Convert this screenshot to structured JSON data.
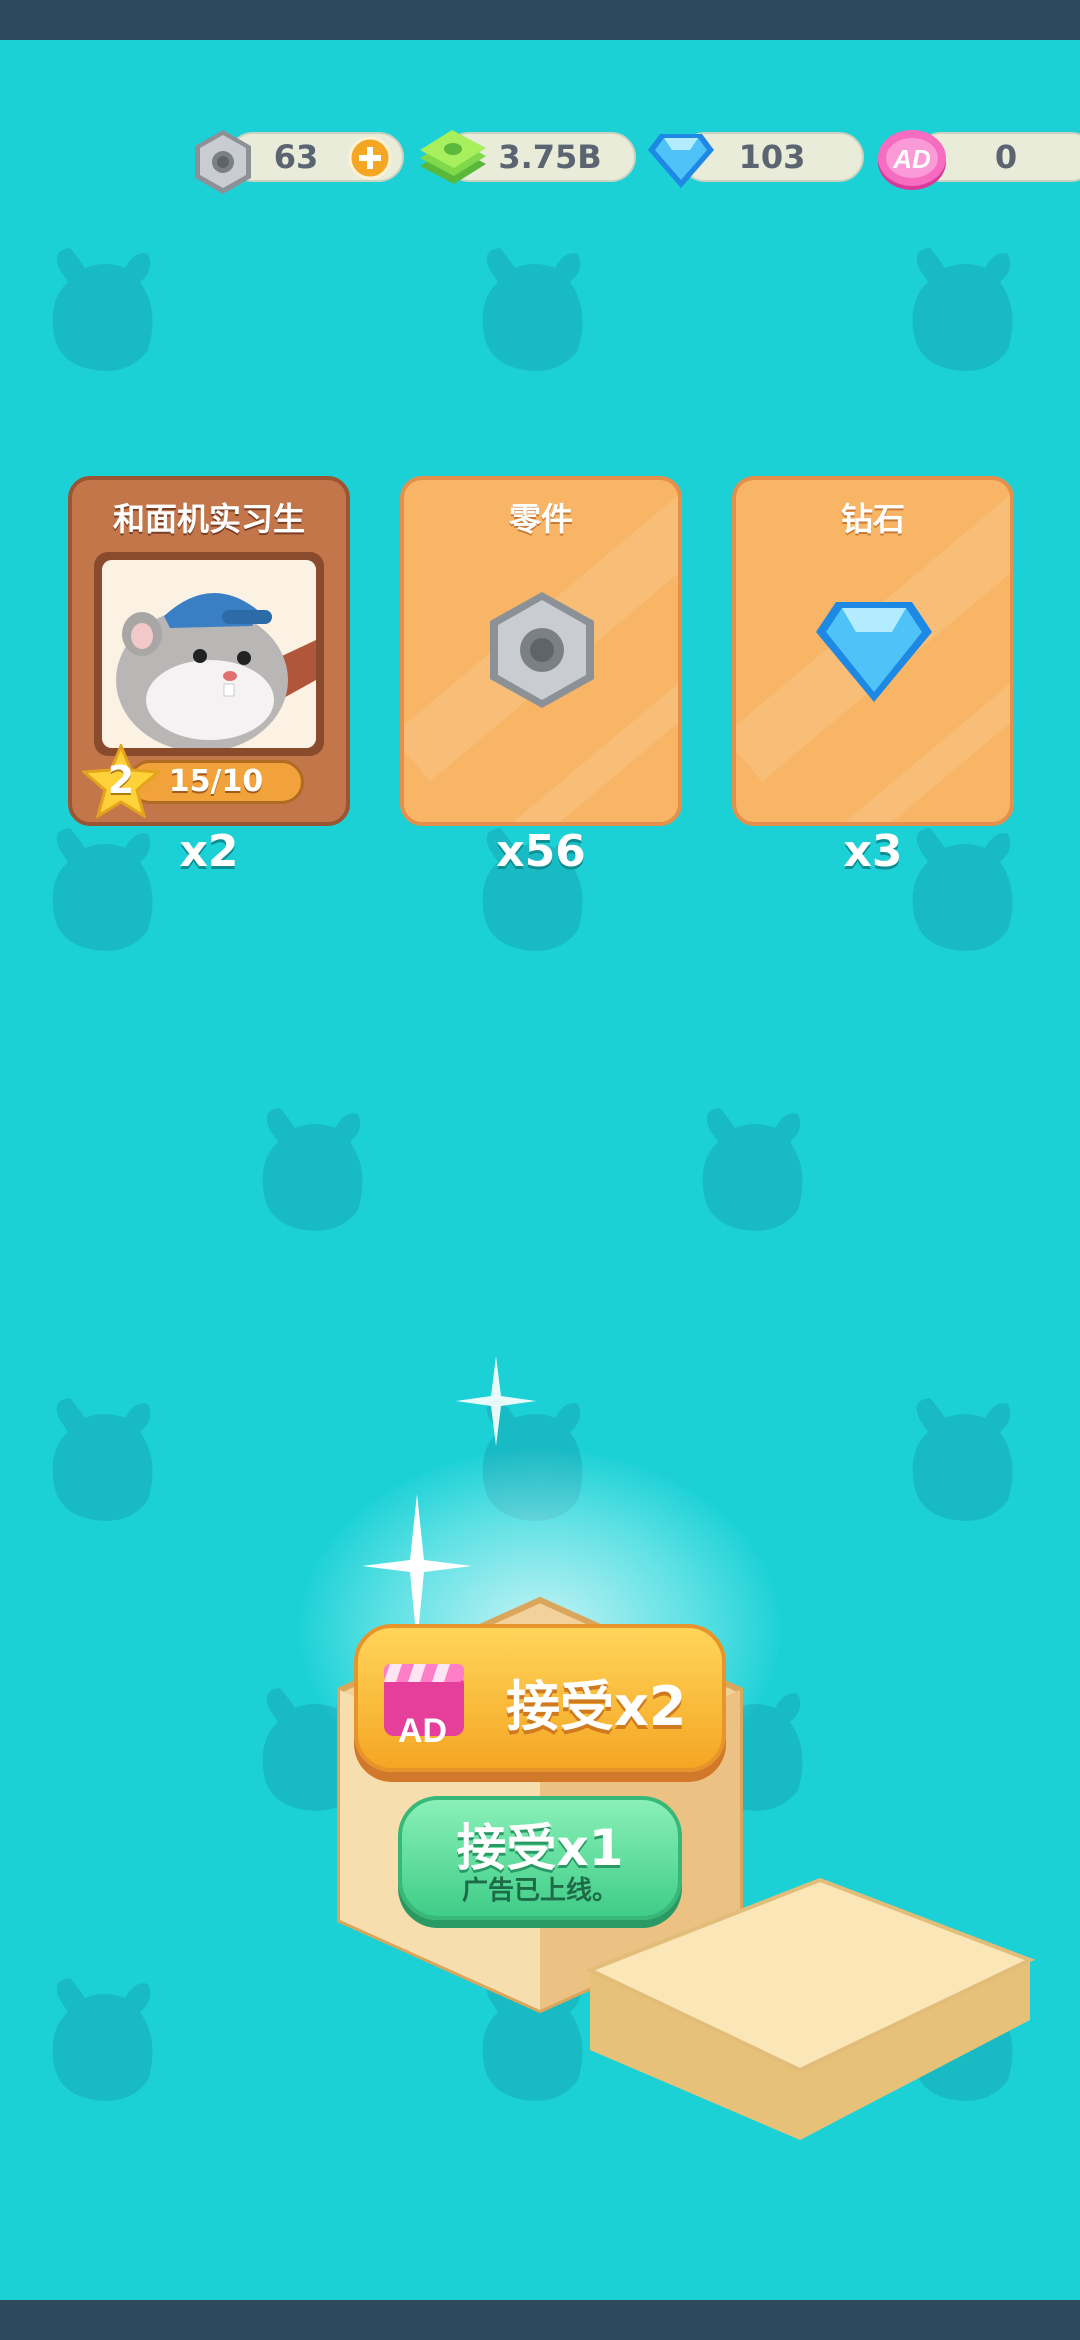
{
  "resources": [
    {
      "icon": "nut-icon",
      "value": "63",
      "has_add": true
    },
    {
      "icon": "cash-icon",
      "value": "3.75B"
    },
    {
      "icon": "diamond-icon",
      "value": "103"
    },
    {
      "icon": "ad-coin-icon",
      "value": "0"
    }
  ],
  "rewards": [
    {
      "title": "和面机实习生",
      "quantity": "x2",
      "level": "2",
      "progress": "15/10",
      "icon": "hamster-worker-portrait"
    },
    {
      "title": "零件",
      "quantity": "x56",
      "icon": "nut-icon"
    },
    {
      "title": "钻石",
      "quantity": "x3",
      "icon": "diamond-icon"
    }
  ],
  "buttons": {
    "accept_double": "接受x2",
    "ad_badge": "AD",
    "accept_single": "接受x1",
    "accept_single_sub": "广告已上线。"
  },
  "colors": {
    "background": "#1bd1d6",
    "accent_orange": "#f5a623",
    "accent_green": "#3fcd88"
  }
}
